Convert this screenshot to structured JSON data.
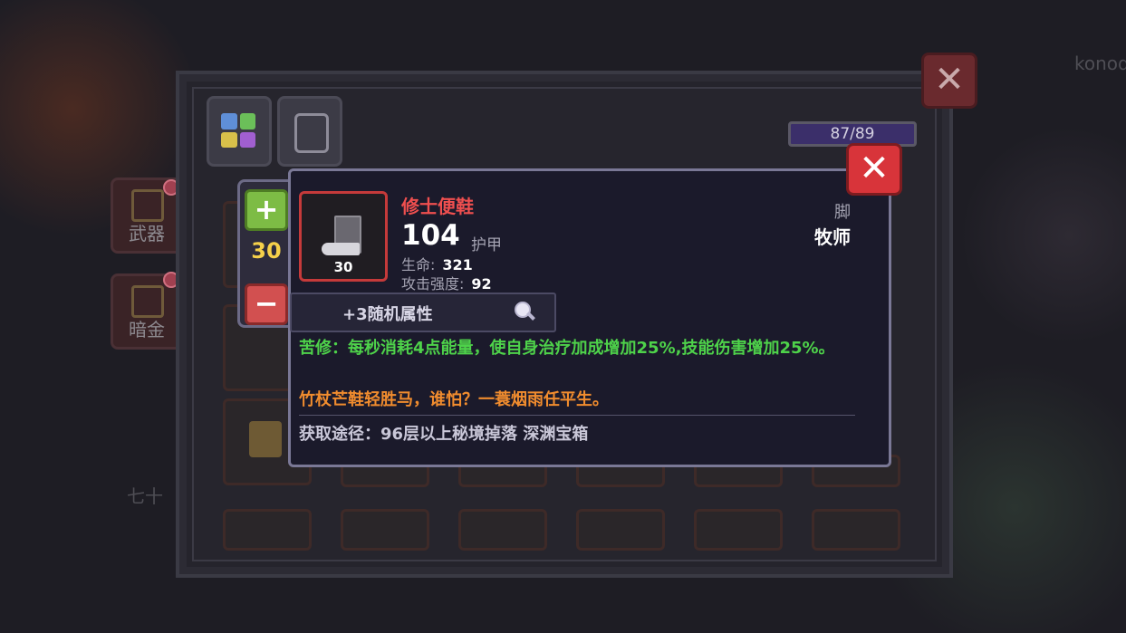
{
  "background": {
    "side_tabs": [
      {
        "label": "武器"
      },
      {
        "label": "暗金"
      }
    ],
    "user_tag": "konod",
    "left_hint": "七十"
  },
  "inventory": {
    "capacity": "87/89",
    "close_symbol": "✕"
  },
  "stepper": {
    "plus_symbol": "+",
    "minus_symbol": "−",
    "count": "30"
  },
  "item": {
    "name": "修士便鞋",
    "name_color": "#ef4f4f",
    "quantity": "30",
    "armor_value": "104",
    "armor_label": "护甲",
    "stats": [
      {
        "label": "生命:",
        "value": "321"
      },
      {
        "label": "攻击强度:",
        "value": "92"
      }
    ],
    "slot_type": "脚",
    "class_requirement": "牧师",
    "random_attributes": "+3随机属性",
    "effect": "苦修：每秒消耗4点能量，使自身治疗加成增加25%,技能伤害增加25%。",
    "flavor": "竹杖芒鞋轻胜马，谁怕？一蓑烟雨任平生。",
    "source": "获取途径：96层以上秘境掉落 深渊宝箱",
    "close_symbol": "✕"
  },
  "colors": {
    "effect_green": "#4ed24a",
    "flavor_orange": "#f08c2e",
    "count_yellow": "#f5d04a",
    "close_red": "#d8343a"
  }
}
